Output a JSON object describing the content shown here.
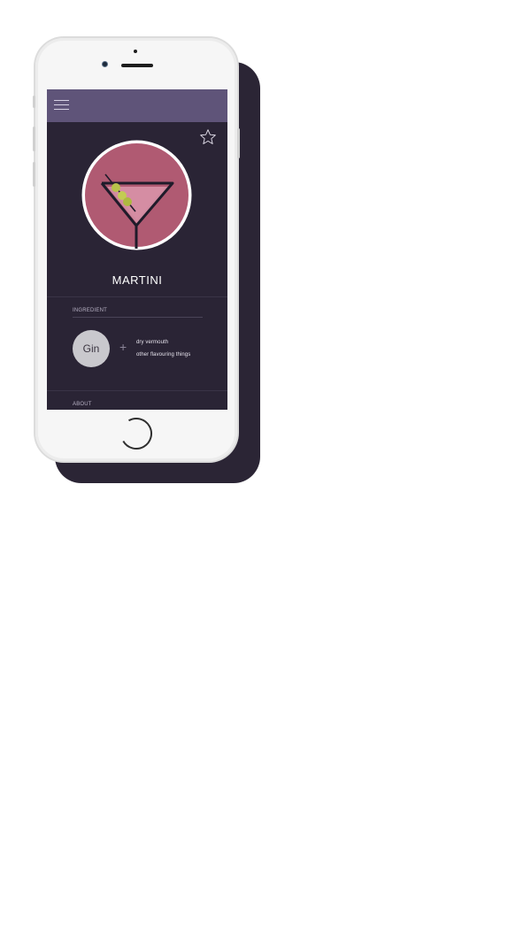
{
  "drink": {
    "name": "MARTINI",
    "main_ingredient": "Gin",
    "plus": "+",
    "other_ingredients": [
      "dry vermouth",
      "other flavouring things"
    ]
  },
  "sections": {
    "ingredient_label": "INGREDIENT",
    "about_label": "ABOUT"
  },
  "icons": {
    "menu": "hamburger-menu-icon",
    "favorite": "star-outline-icon",
    "drink": "martini-glass-icon"
  },
  "colors": {
    "screen_background": "#2a2435",
    "top_bar": "#5f5479",
    "drink_circle": "#b05a72",
    "olive": "#b8c24a",
    "ingredient_circle": "#c9c8cd",
    "phone_shadow": "#2b2535"
  }
}
